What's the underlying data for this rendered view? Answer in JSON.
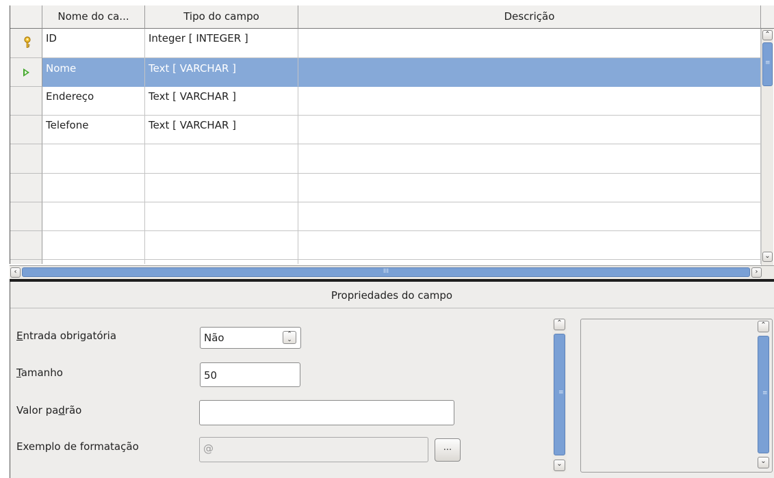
{
  "table": {
    "columns": [
      "Nome do ca...",
      "Tipo do campo",
      "Descrição"
    ],
    "rows": [
      {
        "name": "ID",
        "type": "Integer [ INTEGER ]",
        "description": ""
      },
      {
        "name": "Nome",
        "type": "Text [ VARCHAR ]",
        "description": ""
      },
      {
        "name": "Endereço",
        "type": "Text [ VARCHAR ]",
        "description": ""
      },
      {
        "name": "Telefone",
        "type": "Text [ VARCHAR ]",
        "description": ""
      }
    ],
    "selected_row": 1,
    "primary_key_row": 0
  },
  "icons": {
    "primary_key": "key-icon",
    "current_row": "arrow-right-icon",
    "scroll_up": "chevron-up-icon",
    "scroll_down": "chevron-down-icon",
    "scroll_left": "chevron-left-icon",
    "scroll_right": "chevron-right-icon"
  },
  "properties": {
    "title": "Propriedades do campo",
    "required_label_u": "E",
    "required_label_rest": "ntrada obrigatória",
    "required_value": "Não",
    "size_label_u": "T",
    "size_label_rest": "amanho",
    "size_value": "50",
    "default_label_pre": "Valor pa",
    "default_label_u": "d",
    "default_label_post": "rão",
    "default_value": "",
    "format_label": "Exemplo de formatação",
    "format_value": "@",
    "format_button_label": "..."
  },
  "colors": {
    "selection": "#86a9d8",
    "scroll_thumb": "#7aa0d5"
  }
}
